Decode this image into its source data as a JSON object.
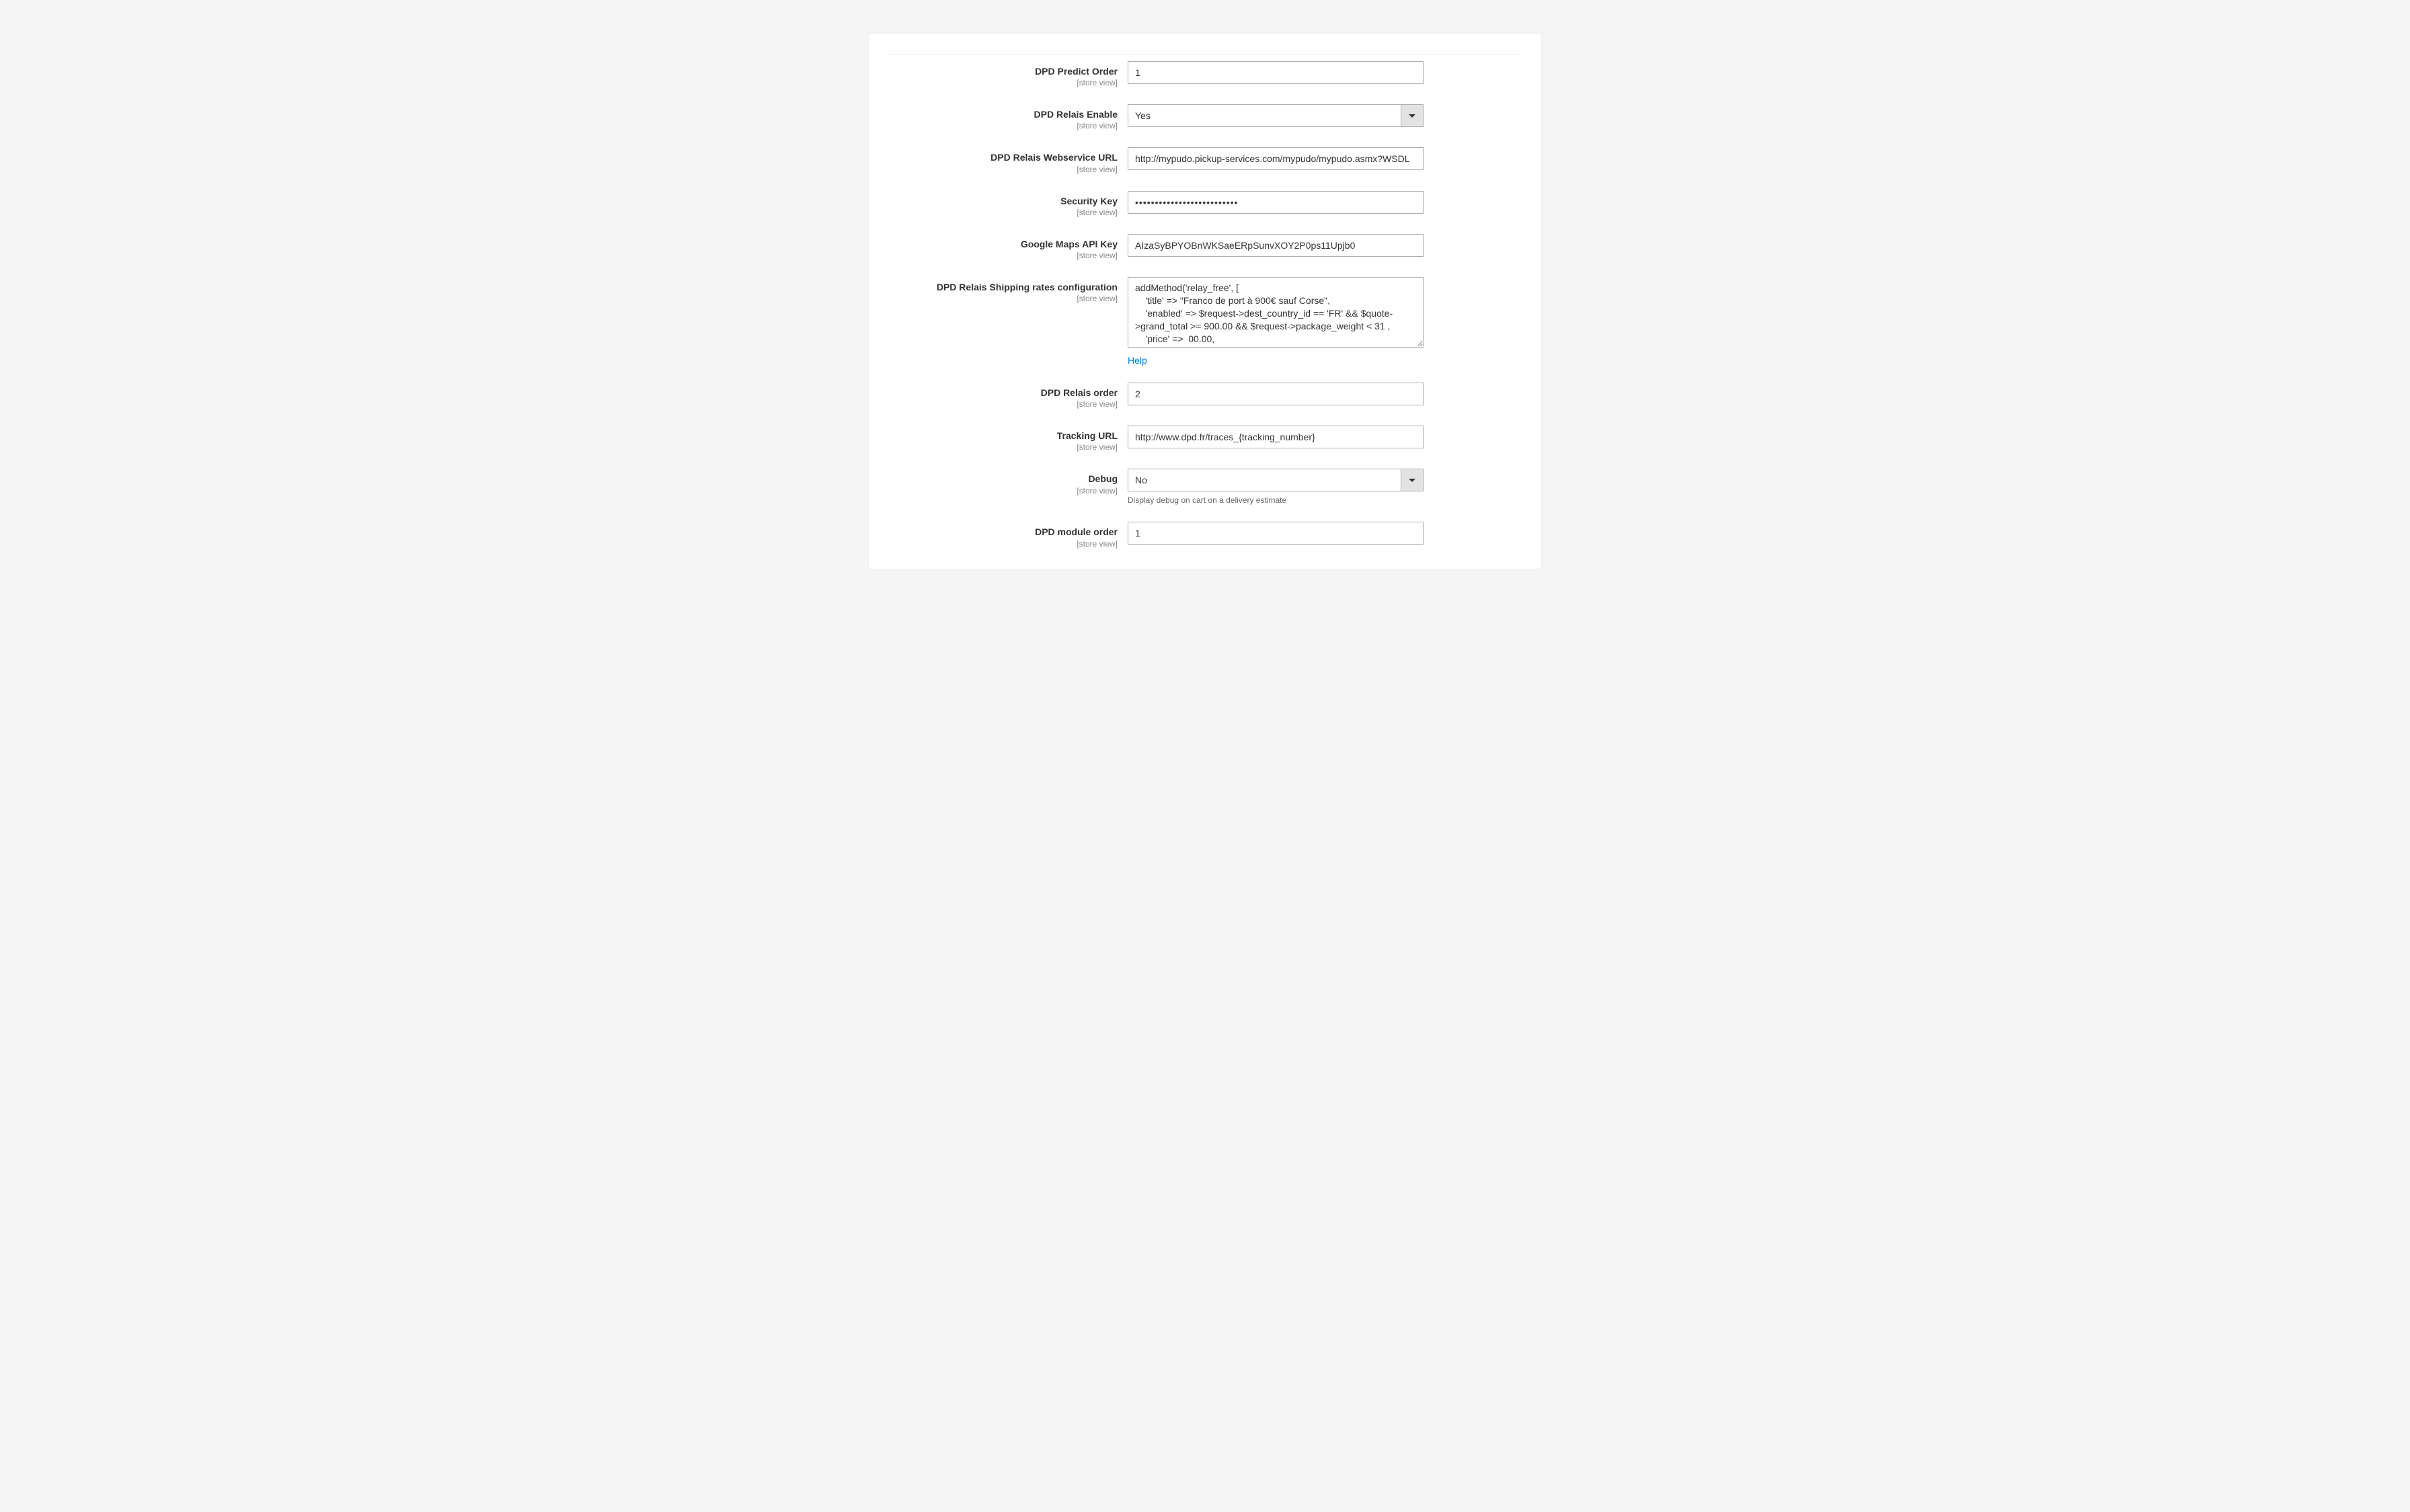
{
  "scope_label": "[store view]",
  "fields": {
    "predict_order": {
      "label": "DPD Predict Order",
      "value": "1"
    },
    "relais_enable": {
      "label": "DPD Relais Enable",
      "value": "Yes"
    },
    "relais_webservice_url": {
      "label": "DPD Relais Webservice URL",
      "value": "http://mypudo.pickup-services.com/mypudo/mypudo.asmx?WSDL"
    },
    "security_key": {
      "label": "Security Key",
      "value": "••••••••••••••••••••••••••"
    },
    "google_maps_api_key": {
      "label": "Google Maps API Key",
      "value": "AIzaSyBPYOBnWKSaeERpSunvXOY2P0ps11Upjb0"
    },
    "relais_shipping_rates": {
      "label": "DPD Relais Shipping rates configuration",
      "value": "addMethod('relay_free', [\n    'title' => \"Franco de port à 900€ sauf Corse\",\n    'enabled' => $request->dest_country_id == 'FR' && $quote->grand_total >= 900.00 && $request->package_weight < 31 ,\n    'price' =>  00.00,",
      "help": "Help"
    },
    "relais_order": {
      "label": "DPD Relais order",
      "value": "2"
    },
    "tracking_url": {
      "label": "Tracking URL",
      "value": "http://www.dpd.fr/traces_{tracking_number}"
    },
    "debug": {
      "label": "Debug",
      "value": "No",
      "note": "Display debug on cart on a delivery estimate"
    },
    "module_order": {
      "label": "DPD module order",
      "value": "1"
    }
  }
}
